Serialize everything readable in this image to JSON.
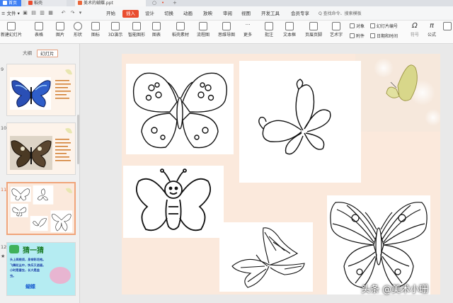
{
  "tabs": {
    "home": "首页",
    "doc1": "稻壳",
    "doc2": "美术的蝴蝶.ppt",
    "add": "+"
  },
  "menu": {
    "file": "文件",
    "items": [
      "开始",
      "插入",
      "设计",
      "切换",
      "动画",
      "放映",
      "审阅",
      "视图",
      "开发工具",
      "会员专享"
    ],
    "active_index": 1,
    "search_placeholder": "Q 查找命令、搜索模板"
  },
  "ribbon": {
    "large": [
      "新建幻灯片",
      "表格",
      "图片",
      "形状",
      "图标",
      "3D演示",
      "智能图形",
      "图表",
      "稻壳素材",
      "流程图",
      "思维导图",
      "更多",
      "批注",
      "文本框",
      "页眉页脚",
      "艺术字"
    ],
    "small": [
      "对象",
      "幻灯片编号",
      "附件",
      "日期和时间"
    ],
    "right": [
      "符号",
      "公式"
    ]
  },
  "left_panel": {
    "tabs": [
      "大纲",
      "幻灯片"
    ],
    "active_tab": 1,
    "slides": [
      {
        "num": "9"
      },
      {
        "num": "10"
      },
      {
        "num": "11"
      },
      {
        "num": "12",
        "title": "猜一猜",
        "lines": [
          "头上两根须，身穿彩花袍。",
          "飞舞花丛中，快乐又逍遥。",
          "小时是害虫，长大是益",
          "虫。"
        ],
        "answer": "蝴蝶"
      }
    ]
  },
  "watermark": "头条 @美术小珊",
  "colors": {
    "accent": "#e94c2f",
    "tab_blue": "#3e7ff3",
    "slide_bg": "#fbe9dc",
    "selected_border": "#f0a47a"
  }
}
